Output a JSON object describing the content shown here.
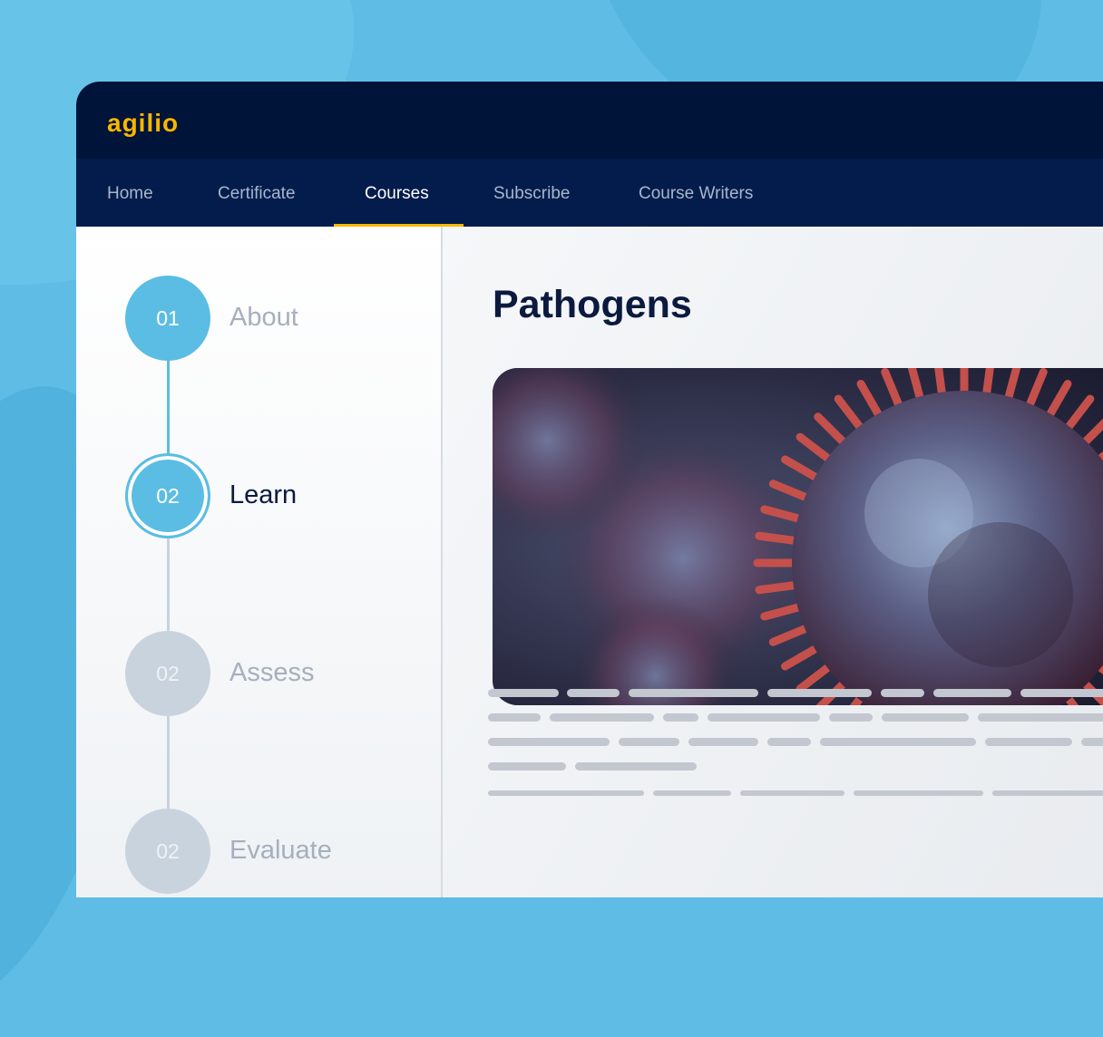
{
  "app": {
    "logo": "agilio"
  },
  "nav": {
    "items": [
      {
        "label": "Home"
      },
      {
        "label": "Certificate"
      },
      {
        "label": "Courses"
      },
      {
        "label": "Subscribe"
      },
      {
        "label": "Course Writers"
      }
    ],
    "active_index": 2
  },
  "steps": [
    {
      "number": "01",
      "label": "About",
      "state": "completed"
    },
    {
      "number": "02",
      "label": "Learn",
      "state": "current"
    },
    {
      "number": "02",
      "label": "Assess",
      "state": "upcoming"
    },
    {
      "number": "02",
      "label": "Evaluate",
      "state": "upcoming"
    }
  ],
  "main": {
    "title": "Pathogens",
    "hero_image": "virus-illustration"
  },
  "colors": {
    "brand": "#f7b700",
    "header": "#001339",
    "nav": "#031c4c",
    "step_active": "#5bbde4",
    "step_inactive": "#c9d3de",
    "background": "#5fbde5"
  }
}
